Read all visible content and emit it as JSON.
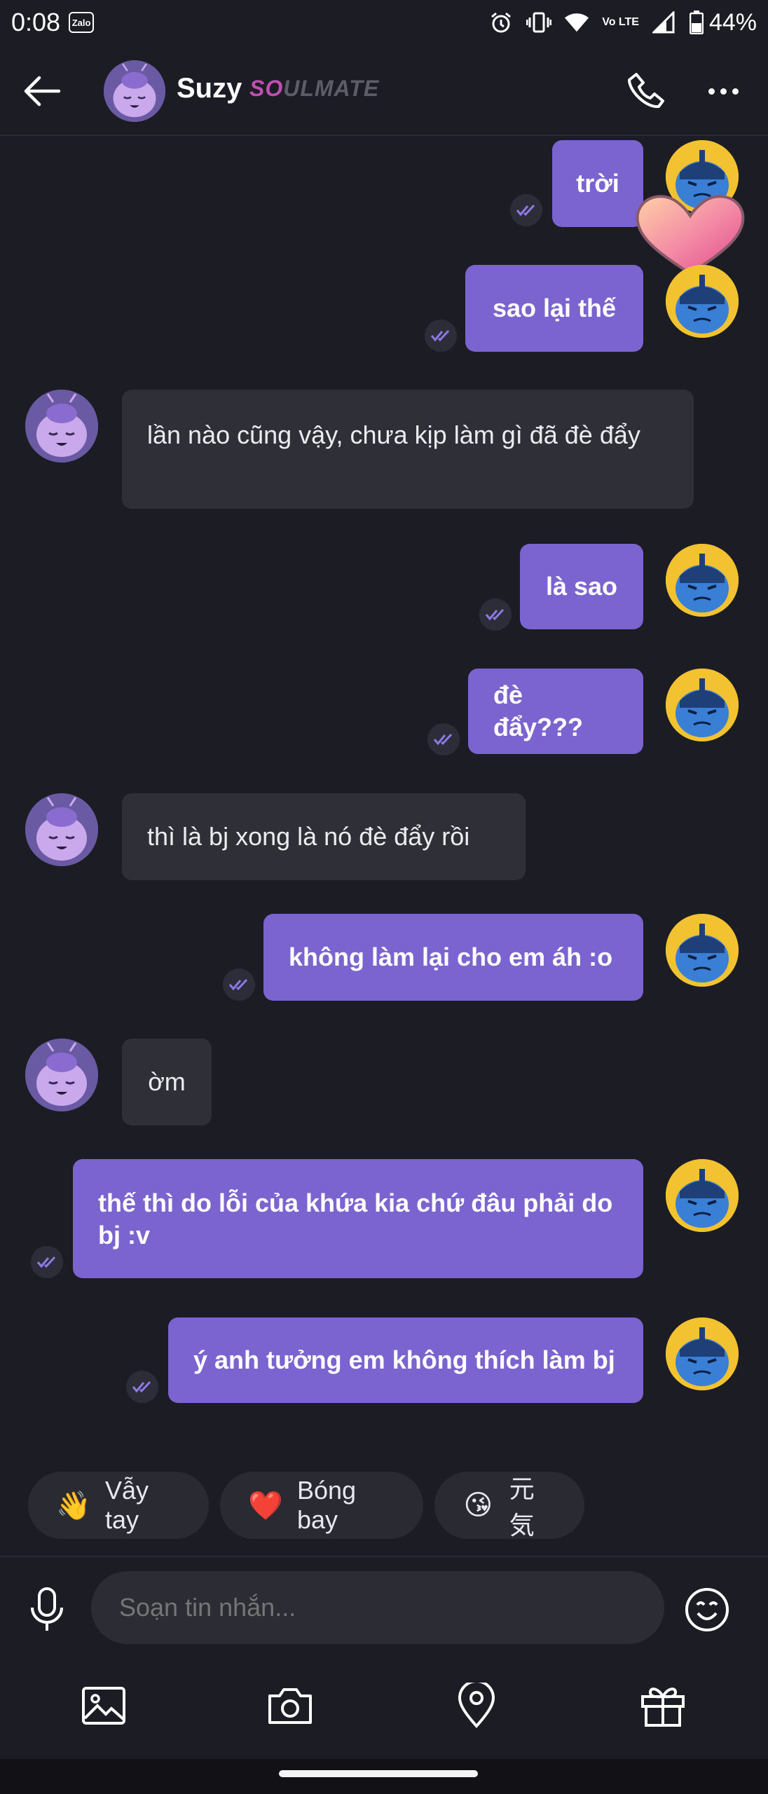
{
  "status_bar": {
    "time": "0:08",
    "app_badge": "Zalo",
    "network": "Vo LTE",
    "battery": "44%",
    "icons": [
      "alarm-icon",
      "vibrate-icon",
      "wifi-icon",
      "signal-icon",
      "battery-icon"
    ]
  },
  "header": {
    "contact_name": "Suzy",
    "badge_prefix": "SO",
    "badge_suffix": "ULMATE",
    "icons": [
      "back-arrow-icon",
      "phone-icon",
      "more-icon"
    ]
  },
  "messages": [
    {
      "from": "me",
      "text": "trời"
    },
    {
      "from": "me",
      "text": "sao lại thế"
    },
    {
      "from": "her",
      "text": "lần nào cũng vậy, chưa kịp làm gì đã đè đẩy"
    },
    {
      "from": "me",
      "text": "là sao"
    },
    {
      "from": "me",
      "text": "đè đẩy???"
    },
    {
      "from": "her",
      "text": "thì là bj xong là nó đè đẩy rồi"
    },
    {
      "from": "me",
      "text": "không làm lại cho em áh :o"
    },
    {
      "from": "her",
      "text": "ờm"
    },
    {
      "from": "me",
      "text": "thế thì do lỗi của khứa kia chứ đâu phải do bj :v"
    },
    {
      "from": "me",
      "text": "ý anh tưởng em không thích làm bj"
    }
  ],
  "quick_replies": [
    {
      "emoji": "👋",
      "label": "Vẫy tay"
    },
    {
      "emoji": "❤️",
      "label": "Bóng bay"
    },
    {
      "emoji": "😘",
      "label": "元気"
    }
  ],
  "composer": {
    "placeholder": "Soạn tin nhắn..."
  },
  "toolbar": [
    "image-icon",
    "camera-icon",
    "location-icon",
    "gift-icon"
  ],
  "colors": {
    "background": "#1c1c24",
    "outgoing_bubble": "#7b64d0",
    "incoming_bubble": "#2f2f37",
    "accent": "#c04db0"
  }
}
